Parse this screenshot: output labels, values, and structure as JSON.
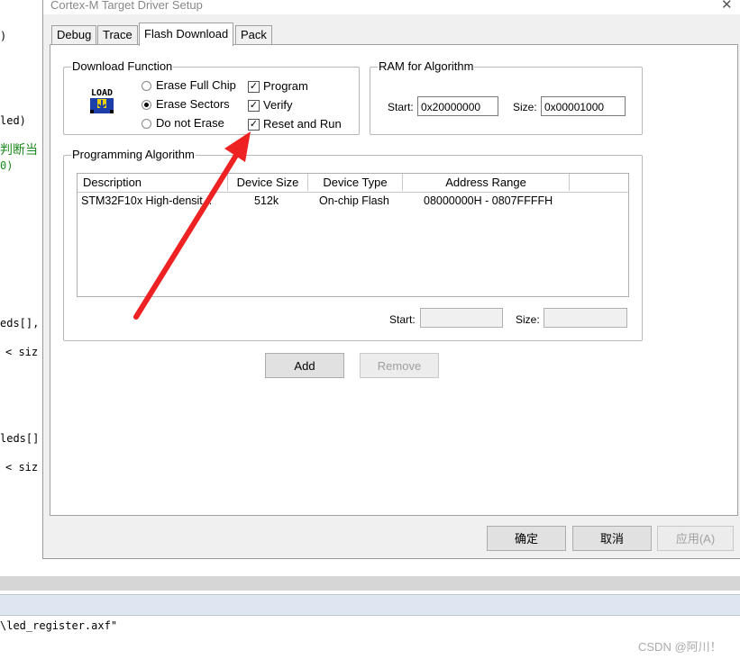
{
  "background": {
    "code_lines": [
      ")",
      "led)",
      "判断当",
      "0)",
      "eds[],",
      "< siz",
      "leds[]",
      "< siz"
    ],
    "console_text": "\\led_register.axf\"",
    "watermark": "CSDN @阿川！"
  },
  "dialog": {
    "title": "Cortex-M Target Driver Setup",
    "tabs": [
      {
        "label": "Debug"
      },
      {
        "label": "Trace"
      },
      {
        "label": "Flash Download"
      },
      {
        "label": "Pack"
      }
    ],
    "download_function": {
      "label": "Download Function",
      "load_icon_text": "LOAD",
      "erase_options": [
        {
          "label": "Erase Full Chip",
          "selected": false
        },
        {
          "label": "Erase Sectors",
          "selected": true
        },
        {
          "label": "Do not Erase",
          "selected": false
        }
      ],
      "checks": [
        {
          "label": "Program",
          "checked": true
        },
        {
          "label": "Verify",
          "checked": true
        },
        {
          "label": "Reset and Run",
          "checked": true
        }
      ]
    },
    "ram_for_algorithm": {
      "label": "RAM for Algorithm",
      "start_label": "Start:",
      "start_value": "0x20000000",
      "size_label": "Size:",
      "size_value": "0x00001000"
    },
    "programming_algorithm": {
      "label": "Programming Algorithm",
      "columns": [
        "Description",
        "Device Size",
        "Device Type",
        "Address Range"
      ],
      "rows": [
        {
          "description": "STM32F10x High-densit...",
          "device_size": "512k",
          "device_type": "On-chip Flash",
          "address_range": "08000000H - 0807FFFFH"
        }
      ],
      "start_label": "Start:",
      "start_value": "",
      "size_label": "Size:",
      "size_value": ""
    },
    "add_label": "Add",
    "remove_label": "Remove",
    "ok_label": "确定",
    "cancel_label": "取消",
    "apply_label": "应用(A)"
  },
  "colors": {
    "arrow": "#ee2222",
    "accent_check": "#000000"
  }
}
